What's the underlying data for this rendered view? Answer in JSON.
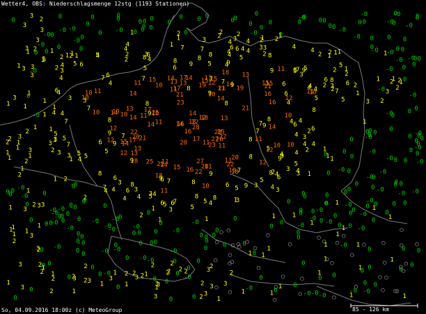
{
  "map": {
    "title": "Wetter4, OBS: Niederschlagsmenge 12stg (1193 Stationen)",
    "footer": "So, 04.09.2016 18:00z (c) MeteoGroup",
    "scale": "85 - 126 km"
  },
  "colors": {
    "background": "#000000",
    "borders": "#7a7a7a",
    "zero_mm": "#00cc00",
    "low_mm": "#ffff00",
    "high_mm": "#ff6a00",
    "no_precip_marker": "#b0b0b0"
  },
  "legend_values_shown": [
    "0",
    "1",
    "2",
    "3",
    "4",
    "5",
    "6",
    "7",
    "8",
    "9",
    "10",
    "11",
    "12",
    "13",
    "14",
    "15",
    "16",
    "17",
    "19",
    "20",
    "21",
    "22",
    "23",
    "24",
    "25",
    "26",
    "27",
    "29",
    "31"
  ]
}
